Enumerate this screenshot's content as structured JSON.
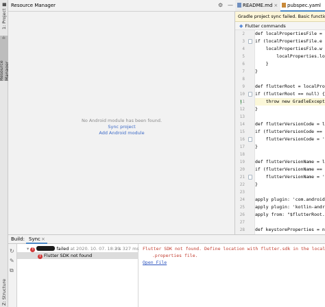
{
  "left_strip": {
    "project_tab": "1: Project",
    "resource_tab": "Resource Manager",
    "structure_tab": "Z: Structure"
  },
  "resource_manager": {
    "title": "Resource Manager",
    "empty_message": "No Android module has been found.",
    "sync_link": "Sync project",
    "add_module_link": "Add Android module"
  },
  "editor": {
    "tabs": [
      {
        "label": "README.md",
        "icon": "markdown-icon"
      },
      {
        "label": "pubspec.yaml",
        "icon": "yaml-icon"
      }
    ],
    "notification": "Gradle project sync failed. Basic functionalit",
    "flutter_commands": "Flutter commands",
    "lines": [
      {
        "n": "2",
        "t": "def localPropertiesFile ="
      },
      {
        "n": "3",
        "t": "if (localPropertiesFile.e"
      },
      {
        "n": "4",
        "t": "    localPropertiesFile.w"
      },
      {
        "n": "5",
        "t": "        localProperties.lo"
      },
      {
        "n": "6",
        "t": "    }"
      },
      {
        "n": "7",
        "t": "}"
      },
      {
        "n": "8",
        "t": ""
      },
      {
        "n": "9",
        "t": "def flutterRoot = localPro"
      },
      {
        "n": "10",
        "t": "if (flutterRoot == null) {"
      },
      {
        "n": "11",
        "t": "    throw new GradleExcepti"
      },
      {
        "n": "12",
        "t": "}"
      },
      {
        "n": "13",
        "t": ""
      },
      {
        "n": "14",
        "t": "def flutterVersionCode = l"
      },
      {
        "n": "15",
        "t": "if (flutterVersionCode == "
      },
      {
        "n": "16",
        "t": "    flutterVersionCode = '"
      },
      {
        "n": "17",
        "t": "}"
      },
      {
        "n": "18",
        "t": ""
      },
      {
        "n": "19",
        "t": "def flutterVersionName = l"
      },
      {
        "n": "20",
        "t": "if (flutterVersionName == "
      },
      {
        "n": "21",
        "t": "    flutterVersionName = '"
      },
      {
        "n": "22",
        "t": "}"
      },
      {
        "n": "23",
        "t": ""
      },
      {
        "n": "24",
        "t": "apply plugin: 'com.android"
      },
      {
        "n": "25",
        "t": "apply plugin: 'kotlin-andr"
      },
      {
        "n": "26",
        "t": "apply from: \"$flutterRoot."
      },
      {
        "n": "27",
        "t": ""
      },
      {
        "n": "28",
        "t": "def keystoreProperties = n"
      }
    ]
  },
  "bottom_panel": {
    "build_label": "Build:",
    "sync_tab": "Sync",
    "close_glyph": "×",
    "tree": {
      "root_status": "failed",
      "root_time": "at 2020. 10. 07. 18:39",
      "root_duration": "2 s 327 ms",
      "child_label": "Flutter SDK not found"
    },
    "console": {
      "error_line1": "Flutter SDK not found. Define location with flutter.sdk in the local",
      "error_line2": ".properties file.",
      "open_file": "Open File"
    }
  }
}
